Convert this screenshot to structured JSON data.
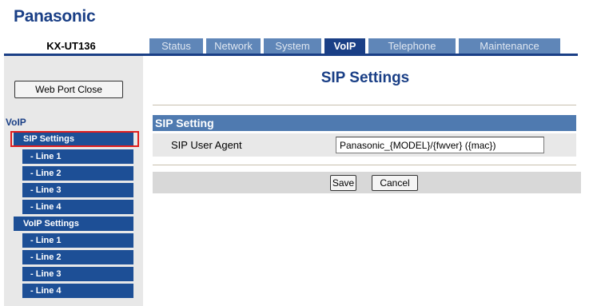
{
  "brand": {
    "logo_text": "Panasonic"
  },
  "device": {
    "model": "KX-UT136"
  },
  "tabs": [
    {
      "label": "Status",
      "active": false
    },
    {
      "label": "Network",
      "active": false
    },
    {
      "label": "System",
      "active": false
    },
    {
      "label": "VoIP",
      "active": true
    },
    {
      "label": "Telephone",
      "active": false
    },
    {
      "label": "Maintenance",
      "active": false
    }
  ],
  "sidebar": {
    "web_port_close_label": "Web Port Close",
    "heading": "VoIP",
    "groups": [
      {
        "label": "SIP Settings",
        "selected": true,
        "items": [
          "- Line 1",
          "- Line 2",
          "- Line 3",
          "- Line 4"
        ]
      },
      {
        "label": "VoIP Settings",
        "selected": false,
        "items": [
          "- Line 1",
          "- Line 2",
          "- Line 3",
          "- Line 4"
        ]
      }
    ]
  },
  "main": {
    "page_title": "SIP Settings",
    "section_title": "SIP Setting",
    "fields": [
      {
        "label": "SIP User Agent",
        "value": "Panasonic_{MODEL}/{fwver} ({mac})"
      }
    ],
    "save_label": "Save",
    "cancel_label": "Cancel"
  },
  "colors": {
    "brand_blue": "#1a3f86",
    "tab_inactive": "#5f86b8",
    "menu_blue": "#1d4f96",
    "section_header": "#4f7ab0",
    "selection_outline": "#e01e1e"
  }
}
